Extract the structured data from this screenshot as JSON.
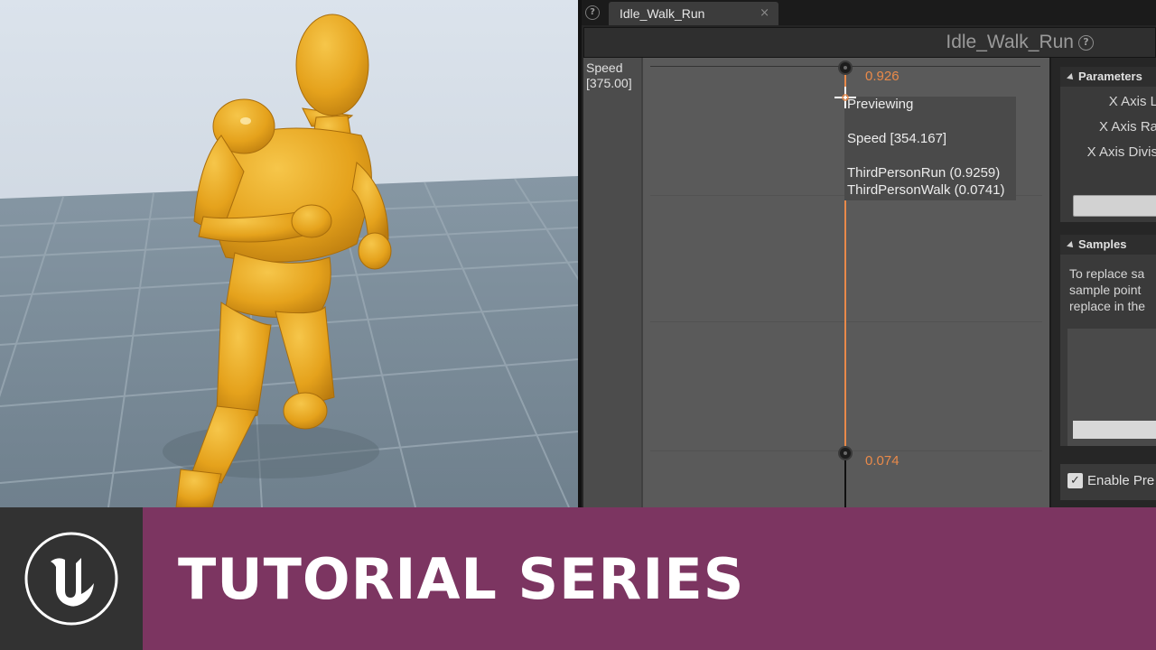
{
  "tab": {
    "title": "Idle_Walk_Run",
    "close": "×"
  },
  "header": {
    "title": "Idle_Walk_Run",
    "help": "?"
  },
  "axis": {
    "name": "Speed",
    "max": "[375.00]"
  },
  "graph": {
    "top_weight": "0.926",
    "bottom_weight": "0.074",
    "tooltip": {
      "title": "Previewing",
      "speed": "Speed [354.167]",
      "run": "ThirdPersonRun (0.9259)",
      "walk": "ThirdPersonWalk (0.0741)"
    }
  },
  "parameters": {
    "title": "Parameters",
    "x_axis_label": "X Axis L",
    "x_axis_range": "X Axis Ra",
    "x_axis_divisions": "X Axis Divis"
  },
  "samples": {
    "title": "Samples",
    "line1": "To replace sa",
    "line2": "sample point",
    "line3": "replace in the"
  },
  "enable": {
    "label": "Enable Pre",
    "checked": "✓"
  },
  "banner": {
    "title": "TUTORIAL SERIES"
  },
  "colors": {
    "accent": "#e98a4a",
    "banner": "#7c3561",
    "mannequin": "#e8a623"
  }
}
